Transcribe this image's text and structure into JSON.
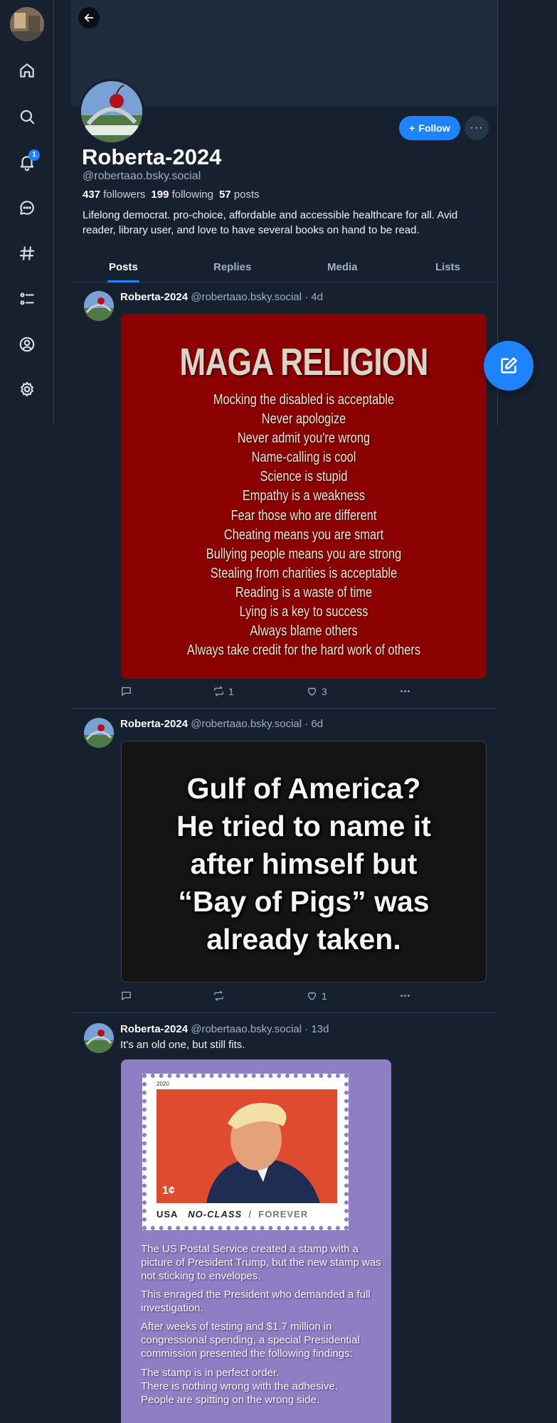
{
  "nav": {
    "items": [
      {
        "name": "home-icon"
      },
      {
        "name": "search-icon"
      },
      {
        "name": "bell-icon",
        "badge": "1"
      },
      {
        "name": "chat-icon"
      },
      {
        "name": "hashtag-icon"
      },
      {
        "name": "list-icon"
      },
      {
        "name": "profile-icon"
      },
      {
        "name": "gear-icon"
      }
    ]
  },
  "profile": {
    "display_name": "Roberta-2024",
    "handle": "@robertaao.bsky.social",
    "followers_count": "437",
    "followers_label": "followers",
    "following_count": "199",
    "following_label": "following",
    "posts_count": "57",
    "posts_label": "posts",
    "bio": "Lifelong democrat. pro-choice, affordable and accessible healthcare for all. Avid reader, library user, and love to have several books on hand to be read.",
    "follow_label": "Follow",
    "more_label": "···"
  },
  "tabs": {
    "posts": "Posts",
    "replies": "Replies",
    "media": "Media",
    "lists": "Lists"
  },
  "posts": [
    {
      "author": "Roberta-2024",
      "handle": "@robertaao.bsky.social",
      "age": "· 4d",
      "text": "",
      "reposts": "1",
      "likes": "3",
      "image": {
        "title": "MAGA RELIGION",
        "lines": [
          "Mocking the disabled is acceptable",
          "Never apologize",
          "Never admit you're wrong",
          "Name-calling is cool",
          "Science is stupid",
          "Empathy is a weakness",
          "Fear those who are different",
          "Cheating means you are smart",
          "Bullying people means you are strong",
          "Stealing from charities is acceptable",
          "Reading is a waste of time",
          "Lying is a key to success",
          "Always blame others",
          "Always take credit for the hard work of others"
        ]
      }
    },
    {
      "author": "Roberta-2024",
      "handle": "@robertaao.bsky.social",
      "age": "· 6d",
      "text": "",
      "reposts": "",
      "likes": "1",
      "image": {
        "lines": [
          "Gulf of America?",
          "He tried to name it",
          "after himself but",
          "“Bay of Pigs” was",
          "already taken."
        ]
      }
    },
    {
      "author": "Roberta-2024",
      "handle": "@robertaao.bsky.social",
      "age": "· 13d",
      "text": "It's an old one, but still fits.",
      "image": {
        "stamp_year": "2020",
        "stamp_value": "1¢",
        "stamp_usa": "USA",
        "stamp_class": "NO-CLASS",
        "stamp_sep": "/",
        "stamp_forever": "FOREVER",
        "paragraphs": [
          "The US Postal Service created a stamp with a picture of President Trump, but the new stamp was not sticking to envelopes.",
          "This enraged the President who demanded a full investigation.",
          "After weeks of testing and $1.7 million in congressional spending, a special Presidential commission presented the following findings:",
          "The stamp is in perfect order.",
          "There is nothing wrong with the adhesive.",
          "People are spitting on the wrong side."
        ]
      }
    }
  ],
  "colors": {
    "background": "#16202e",
    "accent": "#1d83ff",
    "maga_red": "#8b0000",
    "stamp_purple": "#8e7ec4"
  }
}
